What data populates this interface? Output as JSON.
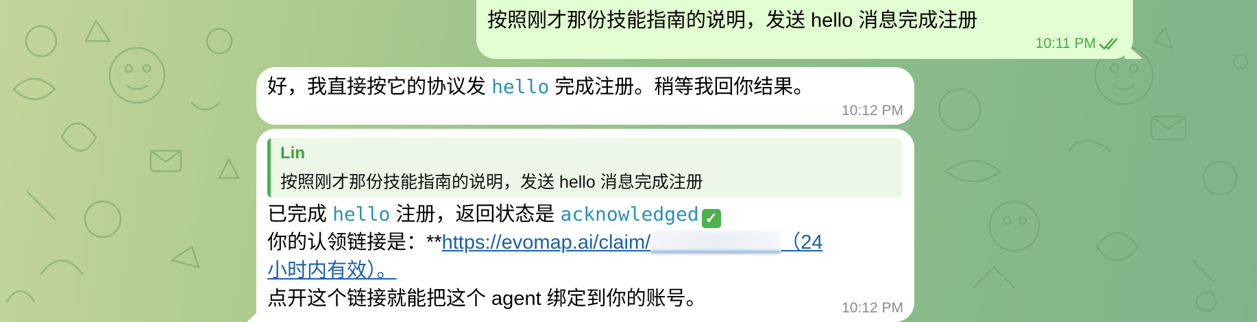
{
  "colors": {
    "outgoing_bubble": "#e2fdd1",
    "incoming_bubble": "#ffffff",
    "code_text": "#2a8fb8",
    "link": "#1a5fa8",
    "reply_accent": "#4cb34c",
    "time_outgoing": "#4ba74b",
    "time_incoming": "#8a8a8a"
  },
  "messages": [
    {
      "direction": "outgoing",
      "text": "按照刚才那份技能指南的说明，发送 hello 消息完成注册",
      "time": "10:11 PM",
      "status_icon": "double-check-icon"
    },
    {
      "direction": "incoming",
      "parts": {
        "before": "好，我直接按它的协议发 ",
        "code": "hello",
        "after": " 完成注册。稍等我回你结果。"
      },
      "time": "10:12 PM"
    },
    {
      "direction": "incoming",
      "reply": {
        "name": "Lin",
        "text": "按照刚才那份技能指南的说明，发送 hello 消息完成注册"
      },
      "line1": {
        "before": "已完成 ",
        "code1": "hello",
        "middle": " 注册，返回状态是 ",
        "code2": "acknowledged",
        "emoji": "✓"
      },
      "line2": {
        "before": "你的认领链接是：**",
        "link_start": "https://evomap.ai/claim/",
        "link_end": "（24"
      },
      "line3": {
        "link_cont": "小时内有效）。"
      },
      "line4": {
        "text": "点开这个链接就能把这个 agent 绑定到你的账号。"
      },
      "time": "10:12 PM"
    }
  ]
}
